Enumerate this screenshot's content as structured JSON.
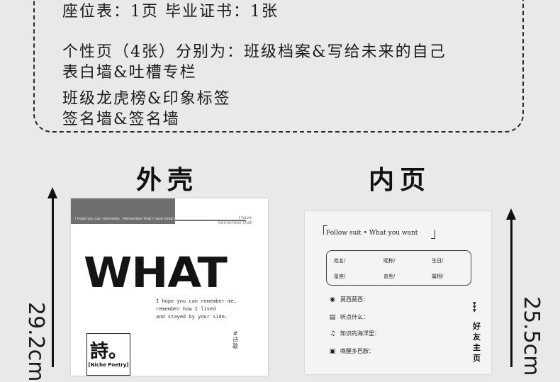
{
  "info": {
    "line1": "座位表：1页   毕业证书：1张",
    "line2": "个性页（4张）分别为：班级档案&写给未来的自己",
    "line3": "表白墙&吐槽专栏",
    "line4": "班级龙虎榜&印象标签",
    "line5": "签名墙&签名墙"
  },
  "titles": {
    "cover": "外壳",
    "inner": "内页"
  },
  "dimensions": {
    "left": "29.2cm",
    "right": "25.5cm"
  },
  "cover": {
    "band_text": "I hope you can remembe",
    "band_text_right": "Remember that I have lived th",
    "corner_text": "I have\nRemember that",
    "what_part1": "WH",
    "what_part2": "A",
    "what_part3": "T",
    "hope_line1": "I hope you can remember me,",
    "hope_line2": "remember how I lived",
    "hope_line3": "and stayed by your side.",
    "sym": "#\n诗\n歌",
    "shi": "詩。",
    "shi_sub": "[Niche Poetry]"
  },
  "inner": {
    "follow": "Follow suit  •  What you want",
    "fields": {
      "name": "姓名/",
      "nickname": "昵称/",
      "birthday": "生日/",
      "constellation": "星座/",
      "blood": "血型/",
      "zodiac": "属相/"
    },
    "questions": [
      "莫西莫西：",
      "听点什么：",
      "知识的海洋里：",
      "唤醒多巴胺："
    ],
    "icons": [
      "chat",
      "note",
      "music",
      "gift"
    ],
    "triangles": "▼\n▼\n▼",
    "vertical": "好友主页"
  }
}
